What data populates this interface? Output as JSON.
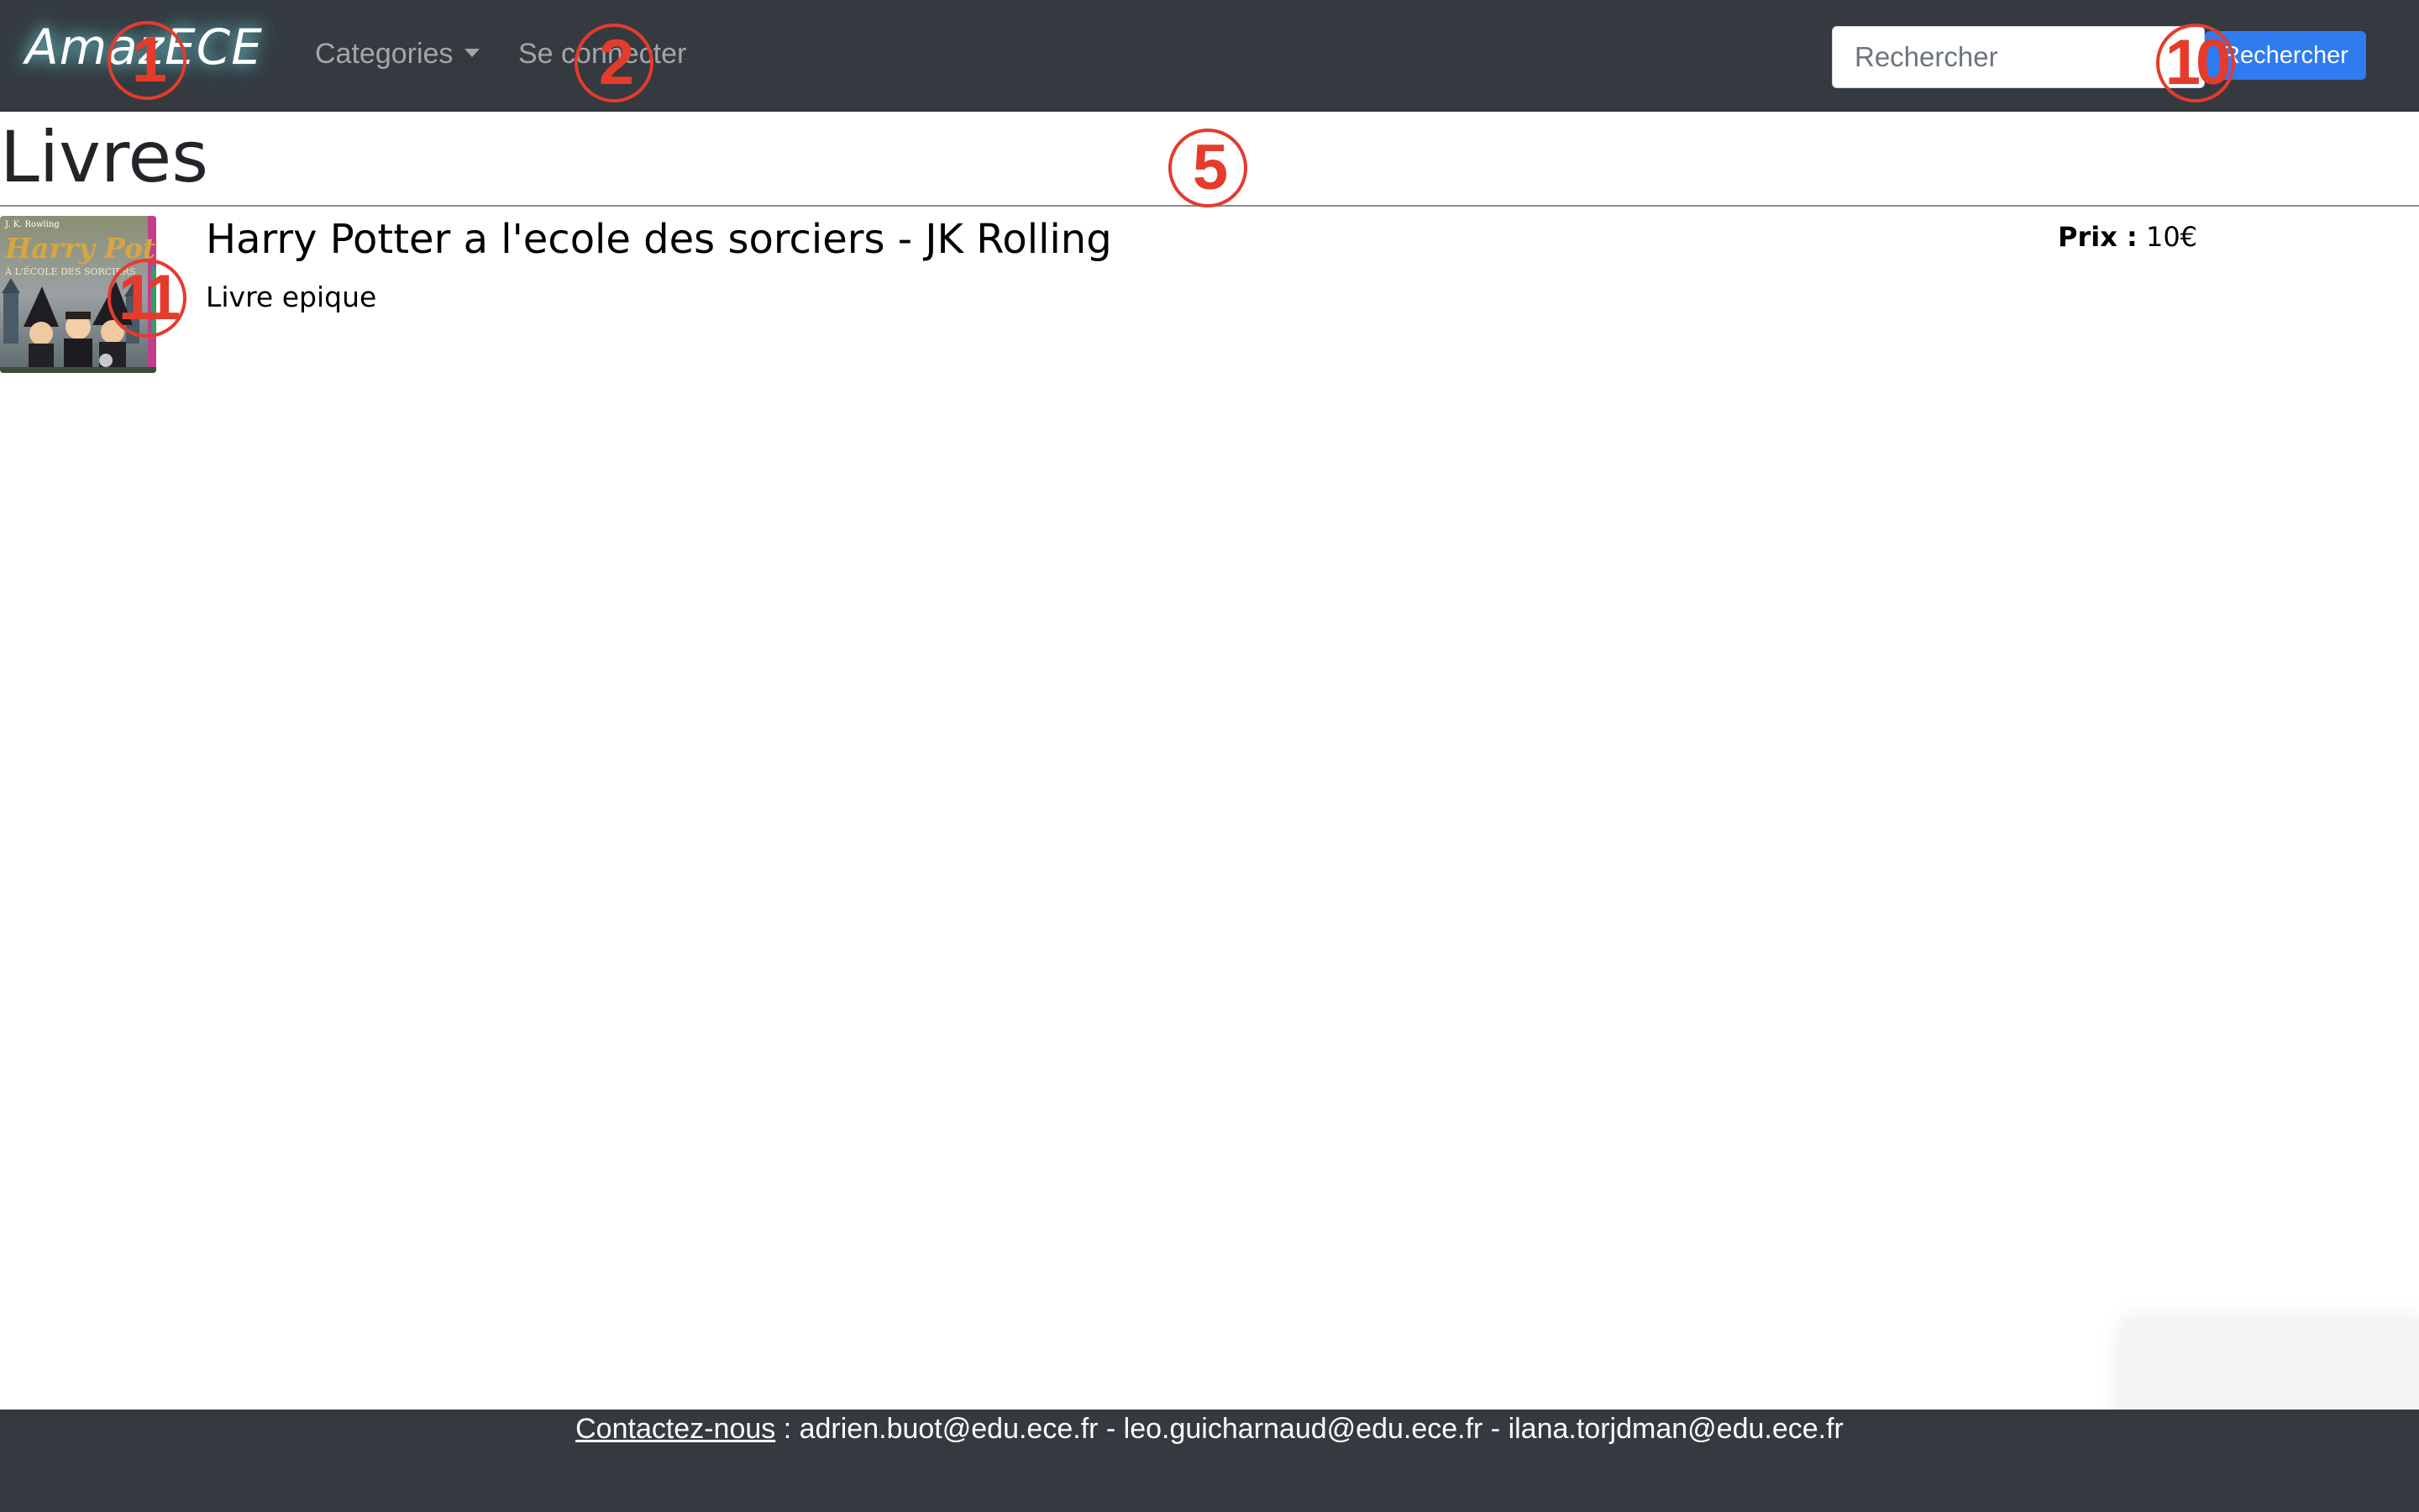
{
  "navbar": {
    "brand": "AmazECE",
    "categories_label": "Categories",
    "login_label": "Se connecter",
    "search": {
      "placeholder": "Rechercher",
      "value": "",
      "button_label": "Rechercher"
    }
  },
  "main": {
    "title": "Livres",
    "products": [
      {
        "title": "Harry Potter a l'ecole des sorciers - JK Rolling",
        "description": "Livre epique",
        "price_label": "Prix :",
        "price_value": "10€",
        "cover_texts": {
          "author": "J. K. Rowling",
          "title": "Harry Potter",
          "subtitle": "À L'ÉCOLE DES SORCIERS"
        }
      }
    ]
  },
  "footer": {
    "contact_link": "Contactez-nous",
    "contact_text": " : adrien.buot@edu.ece.fr - leo.guicharnaud@edu.ece.fr - ilana.torjdman@edu.ece.fr"
  },
  "markers": [
    "1",
    "2",
    "5",
    "10",
    "11"
  ],
  "colors": {
    "navbar_bg": "#343a40",
    "button_primary": "#2f7bf0",
    "marker": "#e53b2c",
    "nav_link": "rgba(255,255,255,0.55)"
  },
  "icons": {
    "categories_dropdown": "caret-down-icon",
    "product_image": "book-cover-image"
  }
}
